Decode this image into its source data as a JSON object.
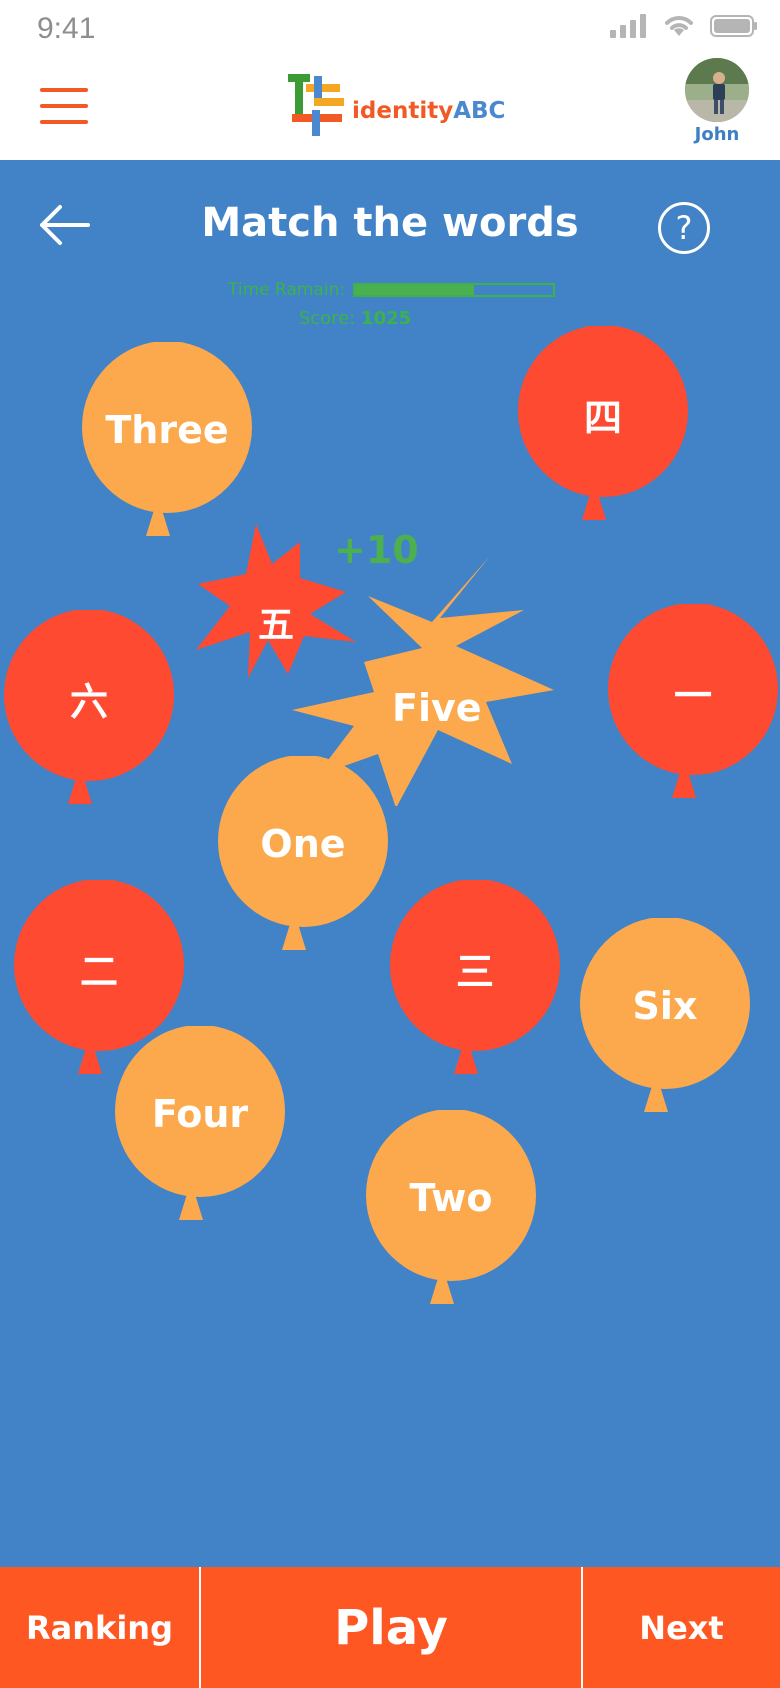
{
  "status_bar": {
    "time": "9:41"
  },
  "header": {
    "logo_text_part1": "identity",
    "logo_text_part2": "ABC",
    "user_name": "John"
  },
  "game": {
    "title": "Match the words",
    "timer_label": "Time Ramain:",
    "time_remaining_fraction": 0.6,
    "score_label": "Score:",
    "score_value": "1025",
    "bonus": "+10",
    "balloons": [
      {
        "label": "Three",
        "color": "#fca94e"
      },
      {
        "label": "四",
        "color": "#fe4a31"
      },
      {
        "label": "六",
        "color": "#fe4a31"
      },
      {
        "label": "一",
        "color": "#fe4a31"
      },
      {
        "label": "One",
        "color": "#fca94e"
      },
      {
        "label": "二",
        "color": "#fe4a31"
      },
      {
        "label": "三",
        "color": "#fe4a31"
      },
      {
        "label": "Six",
        "color": "#fca94e"
      },
      {
        "label": "Four",
        "color": "#fca94e"
      },
      {
        "label": "Two",
        "color": "#fca94e"
      }
    ],
    "popped": [
      {
        "label": "五",
        "color": "#fe4a31"
      },
      {
        "label": "Five",
        "color": "#fca94e"
      }
    ]
  },
  "bottom_bar": {
    "ranking": "Ranking",
    "play": "Play",
    "next": "Next"
  },
  "colors": {
    "accent": "#f15a24",
    "background": "#4183c6",
    "orange_balloon": "#fca94e",
    "red_balloon": "#fe4a31",
    "bottom_button": "#ff5722",
    "timer_green": "#4caf50"
  },
  "icons": {
    "menu": "hamburger-icon",
    "back": "arrow-left-icon",
    "help": "question-circle-icon",
    "signal": "cellular-signal-icon",
    "wifi": "wifi-icon",
    "battery": "battery-icon"
  }
}
